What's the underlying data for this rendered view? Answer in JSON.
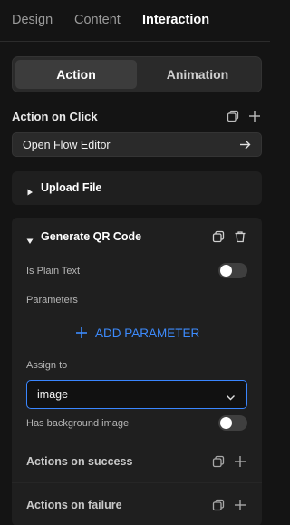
{
  "tabs": [
    {
      "label": "Design",
      "active": false
    },
    {
      "label": "Content",
      "active": false
    },
    {
      "label": "Interaction",
      "active": true
    }
  ],
  "segmented": {
    "options": [
      {
        "label": "Action",
        "active": true
      },
      {
        "label": "Animation",
        "active": false
      }
    ]
  },
  "action_on_click": {
    "title": "Action on Click",
    "flow_editor_label": "Open Flow Editor"
  },
  "upload_file": {
    "title": "Upload File",
    "expanded": false
  },
  "generate_qr": {
    "title": "Generate QR Code",
    "expanded": true,
    "plain_text_label": "Is Plain Text",
    "plain_text_on": false,
    "parameters_label": "Parameters",
    "add_parameter_label": "ADD PARAMETER",
    "assign_to_label": "Assign to",
    "assign_to_value": "image",
    "background_label": "Has background image",
    "background_on": false,
    "success_label": "Actions on success",
    "failure_label": "Actions on failure"
  },
  "colors": {
    "accent": "#3d8bfd",
    "background": "#141414",
    "card": "#1f1f1f"
  },
  "icons": [
    "duplicate-icon",
    "plus-icon",
    "arrow-right-icon",
    "caret-right-icon",
    "caret-down-icon",
    "trash-icon",
    "chevron-down-icon"
  ]
}
